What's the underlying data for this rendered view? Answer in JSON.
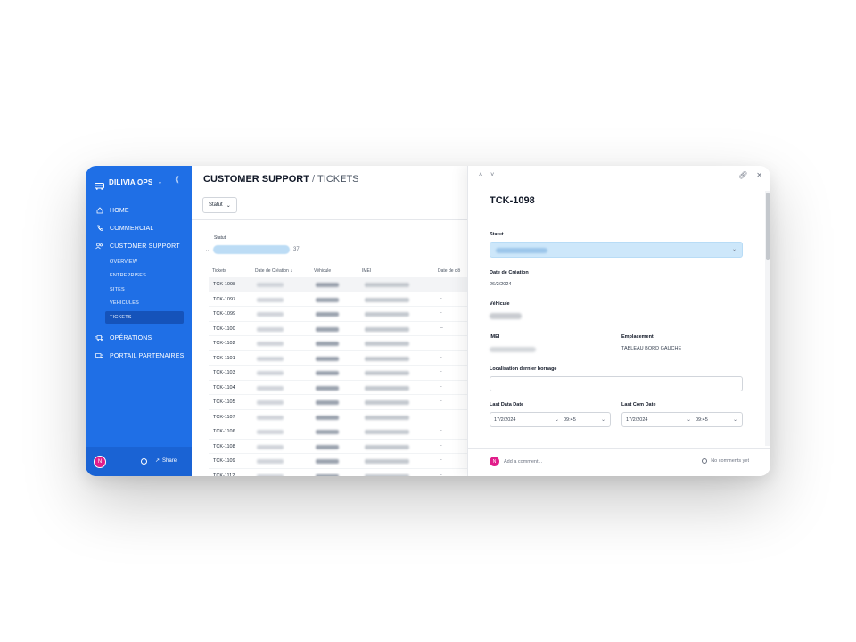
{
  "sidebar": {
    "brand": "DILIVIA OPS",
    "nav": [
      {
        "label": "HOME",
        "icon": "home-icon"
      },
      {
        "label": "COMMERCIAL",
        "icon": "phone-icon"
      },
      {
        "label": "CUSTOMER SUPPORT",
        "icon": "users-icon"
      }
    ],
    "sub_items": [
      "OVERVIEW",
      "ENTREPRISES",
      "SITES",
      "VÉHICULES",
      "TICKETS"
    ],
    "active_sub": "TICKETS",
    "nav_bottom": [
      {
        "label": "OPÉRATIONS",
        "icon": "truck-fast-icon"
      },
      {
        "label": "PORTAIL PARTENAIRES",
        "icon": "truck-icon"
      }
    ],
    "user_initial": "N",
    "share_label": "Share"
  },
  "header": {
    "section": "CUSTOMER SUPPORT",
    "separator": "/",
    "page": "TICKETS"
  },
  "filter": {
    "label": "Statut"
  },
  "group": {
    "label": "Statut",
    "count": "37"
  },
  "table": {
    "columns": [
      "Tickets",
      "Date de Création ↓",
      "Véhicule",
      "IMEI",
      "Date de clô"
    ],
    "rows": [
      {
        "id": "TCK-1098",
        "last": ""
      },
      {
        "id": "TCK-1097",
        "last": "-"
      },
      {
        "id": "TCK-1099",
        "last": "-"
      },
      {
        "id": "TCK-1100",
        "last": "–"
      },
      {
        "id": "TCK-1102",
        "last": ""
      },
      {
        "id": "TCK-1101",
        "last": "-"
      },
      {
        "id": "TCK-1103",
        "last": "-"
      },
      {
        "id": "TCK-1104",
        "last": "-"
      },
      {
        "id": "TCK-1105",
        "last": "-"
      },
      {
        "id": "TCK-1107",
        "last": "-"
      },
      {
        "id": "TCK-1106",
        "last": "-"
      },
      {
        "id": "TCK-1108",
        "last": "-"
      },
      {
        "id": "TCK-1109",
        "last": "-"
      },
      {
        "id": "TCK-1112",
        "last": "-"
      }
    ]
  },
  "detail": {
    "title": "TCK-1098",
    "statut_label": "Statut",
    "date_creation_label": "Date de Création",
    "date_creation_value": "26/2/2024",
    "vehicule_label": "Véhicule",
    "imei_label": "IMEI",
    "emplacement_label": "Emplacement",
    "emplacement_value": "TABLEAU BORD GAUCHE",
    "localisation_label": "Localisation dernier bornage",
    "last_data_label": "Last Data Date",
    "last_data_date": "17/2/2024",
    "last_data_time": "09:45",
    "last_com_label": "Last Com Date",
    "last_com_date": "17/2/2024",
    "last_com_time": "09:45",
    "comment_placeholder": "Add a comment...",
    "no_comments": "No comments yet",
    "user_initial": "N"
  },
  "colors": {
    "sidebar": "#1f6fe6",
    "active_item": "#1552b8",
    "status_fill": "#cde7fa",
    "avatar": "#e11d8a"
  }
}
